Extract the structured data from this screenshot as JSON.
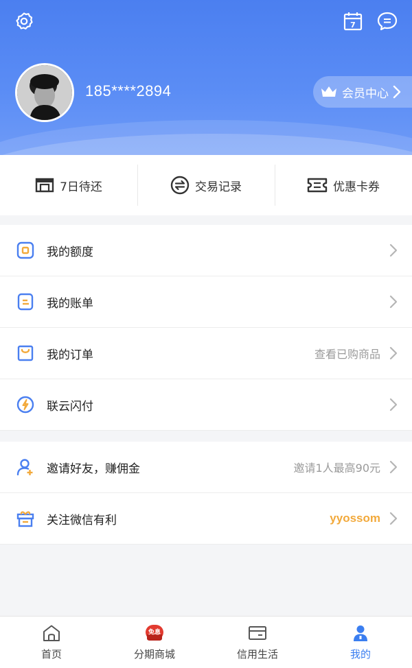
{
  "colors": {
    "primary": "#4b7ff0",
    "accent": "#3b7ef0",
    "hint": "#9a9a9a",
    "brand_text": "#f2a93b",
    "sale_badge": "#e23b30"
  },
  "header": {
    "settings_icon": "gear-icon",
    "calendar_day": "7",
    "phone": "185****2894",
    "member_label": "会员中心"
  },
  "quick_actions": [
    {
      "label": "7日待还",
      "icon": "wallet-icon"
    },
    {
      "label": "交易记录",
      "icon": "exchange-icon"
    },
    {
      "label": "优惠卡券",
      "icon": "ticket-icon"
    }
  ],
  "menu_group_1": [
    {
      "label": "我的额度",
      "hint": "",
      "icon": "quota-icon"
    },
    {
      "label": "我的账单",
      "hint": "",
      "icon": "bill-icon"
    },
    {
      "label": "我的订单",
      "hint": "查看已购商品",
      "icon": "bag-icon"
    },
    {
      "label": "联云闪付",
      "hint": "",
      "icon": "lightning-icon"
    }
  ],
  "menu_group_2": [
    {
      "label": "邀请好友，赚佣金",
      "hint": "邀请1人最高90元",
      "icon": "invite-icon"
    },
    {
      "label": "关注微信有利",
      "hint": "yyossom",
      "icon": "gift-icon"
    }
  ],
  "tabbar": {
    "items": [
      {
        "label": "首页",
        "icon": "home-icon"
      },
      {
        "label": "分期商城",
        "icon": "shop-badge-icon",
        "badge": "免息"
      },
      {
        "label": "信用生活",
        "icon": "card-icon"
      },
      {
        "label": "我的",
        "icon": "user-icon"
      }
    ],
    "active_index": 3
  }
}
